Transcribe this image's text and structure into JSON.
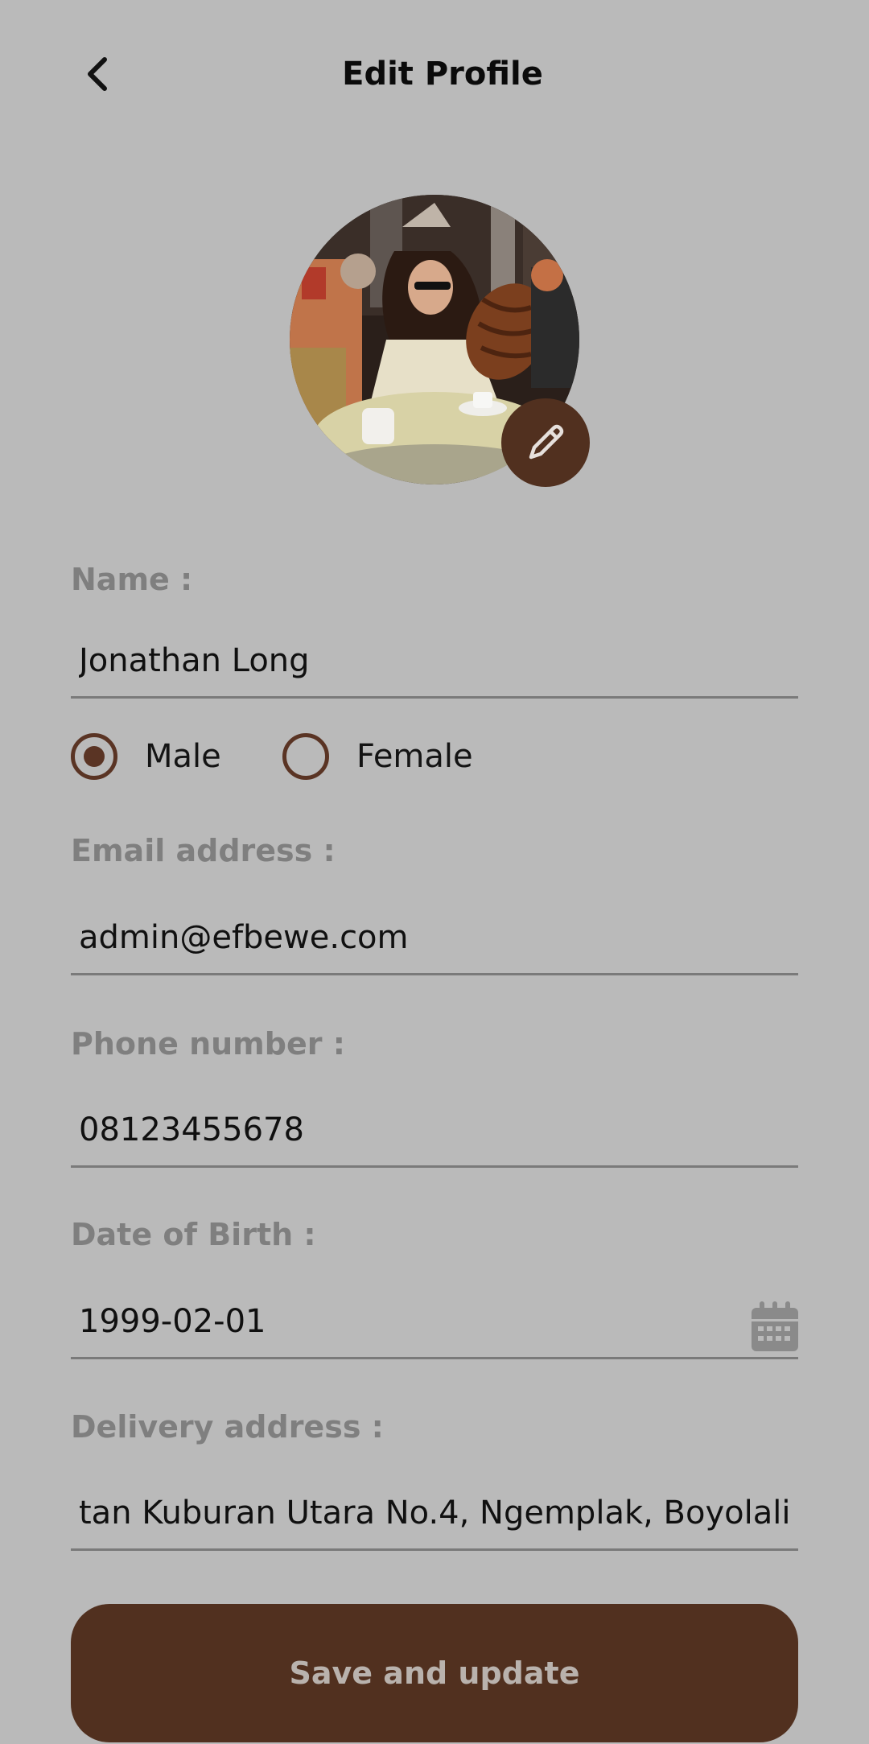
{
  "header": {
    "title": "Edit Profile",
    "back_icon": "chevron-left-icon"
  },
  "avatar": {
    "edit_icon": "pencil-icon"
  },
  "form": {
    "name_label": "Name :",
    "name_value": "Jonathan Long",
    "gender": {
      "options": [
        "Male",
        "Female"
      ],
      "selected": "Male"
    },
    "email_label": "Email address :",
    "email_value": "admin@efbewe.com",
    "phone_label": "Phone number :",
    "phone_value": "08123455678",
    "dob_label": "Date of Birth :",
    "dob_value": "1999-02-01",
    "dob_icon": "calendar-icon",
    "address_label": "Delivery address :",
    "address_value": "tan Kuburan Utara No.4, Ngemplak, Boyolali"
  },
  "actions": {
    "save_label": "Save and update"
  },
  "colors": {
    "background": "#bababa",
    "primary": "#51301f",
    "label": "#7f7f7f",
    "underline": "#7a7a7a"
  }
}
